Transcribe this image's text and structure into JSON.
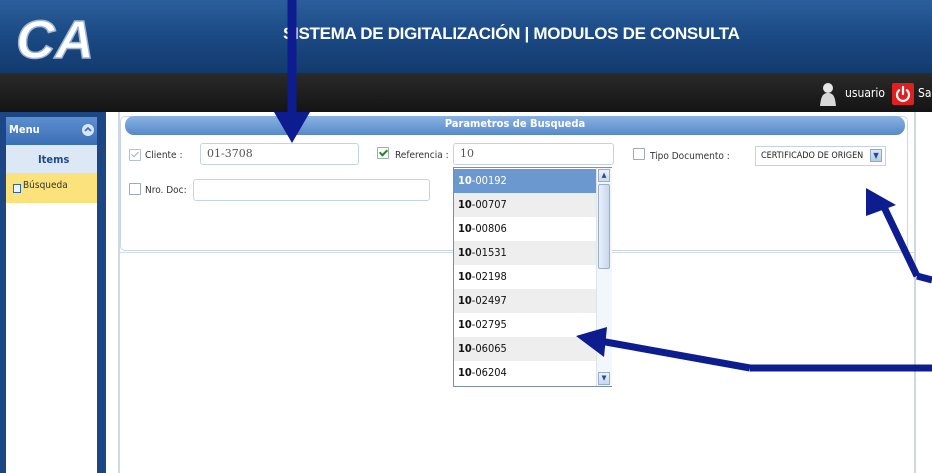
{
  "header": {
    "logo_text": "CA",
    "title": "SISTEMA DE DIGITALIZACIÓN | MODULOS DE CONSULTA"
  },
  "topbar": {
    "username": "usuario",
    "logout_label": "Sal"
  },
  "sidebar": {
    "menu_title": "Menu",
    "section_label": "Items",
    "items": [
      {
        "label": "Búsqueda",
        "icon": "search-icon"
      }
    ]
  },
  "search_panel": {
    "title": "Parametros de Busqueda",
    "cliente": {
      "label": "Cliente :",
      "value": "01-3708",
      "checked": true
    },
    "referencia": {
      "label": "Referencia :",
      "value": "10",
      "checked": true
    },
    "tipo_documento": {
      "label": "Tipo Documento :",
      "selected": "CERTIFICADO DE ORIGEN",
      "checked": false
    },
    "nro_doc": {
      "label": "Nro. Doc:",
      "value": "",
      "checked": false
    }
  },
  "autocomplete": {
    "match_prefix": "10",
    "options": [
      {
        "prefix": "10",
        "rest": "-00192"
      },
      {
        "prefix": "10",
        "rest": "-00707"
      },
      {
        "prefix": "10",
        "rest": "-00806"
      },
      {
        "prefix": "10",
        "rest": "-01531"
      },
      {
        "prefix": "10",
        "rest": "-02198"
      },
      {
        "prefix": "10",
        "rest": "-02497"
      },
      {
        "prefix": "10",
        "rest": "-02795"
      },
      {
        "prefix": "10",
        "rest": "-06065"
      },
      {
        "prefix": "10",
        "rest": "-06204"
      }
    ],
    "selected_index": 0
  },
  "annotation_color": "#0d1d8f"
}
